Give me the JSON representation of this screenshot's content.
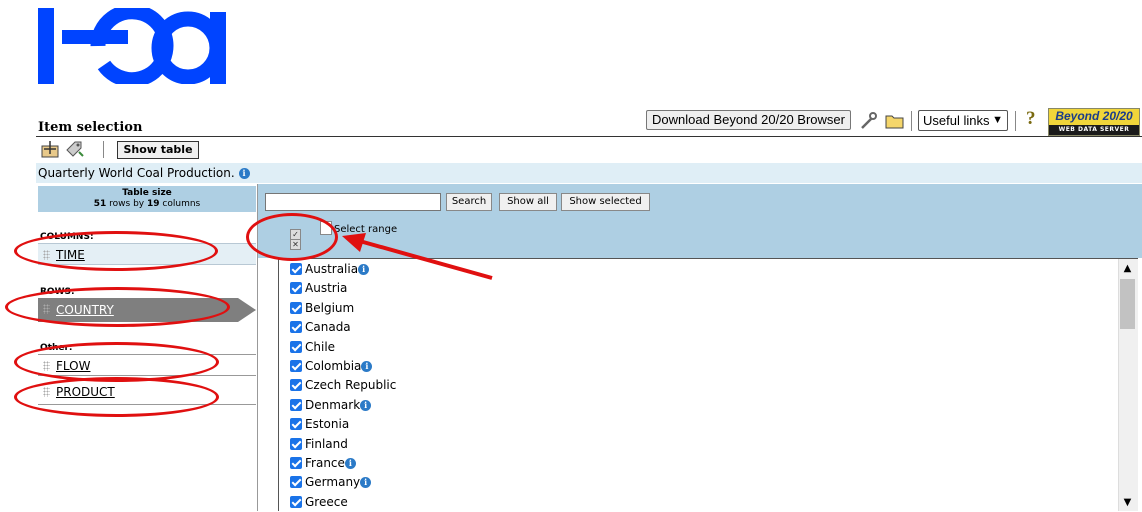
{
  "logo": {
    "text": "iea",
    "color": "#0044ff"
  },
  "header": {
    "item_selection": "Item selection",
    "download_button": "Download Beyond 20/20 Browser",
    "useful_links": "Useful links",
    "help": "?",
    "brand_top": "Beyond 20/20",
    "brand_bottom": "WEB DATA SERVER"
  },
  "toolbar": {
    "show_table": "Show table"
  },
  "title": "Quarterly World Coal Production.",
  "table_size": {
    "heading": "Table size",
    "rows": "51",
    "rows_label": "rows by",
    "cols": "19",
    "cols_label": "columns"
  },
  "dimensions": {
    "columns_label": "COLUMNS:",
    "rows_label": "ROWS:",
    "other_label": "Other:",
    "time": "TIME",
    "country": "COUNTRY",
    "flow": "FLOW",
    "product": "PRODUCT"
  },
  "controls": {
    "search": "Search",
    "show_all": "Show all",
    "show_selected": "Show selected",
    "select_range": "Select range",
    "search_value": ""
  },
  "countries": [
    {
      "name": "Australia",
      "info": true
    },
    {
      "name": "Austria",
      "info": false
    },
    {
      "name": "Belgium",
      "info": false
    },
    {
      "name": "Canada",
      "info": false
    },
    {
      "name": "Chile",
      "info": false
    },
    {
      "name": "Colombia",
      "info": true
    },
    {
      "name": "Czech Republic",
      "info": false
    },
    {
      "name": "Denmark",
      "info": true
    },
    {
      "name": "Estonia",
      "info": false
    },
    {
      "name": "Finland",
      "info": false
    },
    {
      "name": "France",
      "info": true
    },
    {
      "name": "Germany",
      "info": true
    },
    {
      "name": "Greece",
      "info": false
    }
  ],
  "colors": {
    "panel_blue": "#aecfe3",
    "annotation_red": "#e01010",
    "checkbox_blue": "#1a73e8"
  }
}
